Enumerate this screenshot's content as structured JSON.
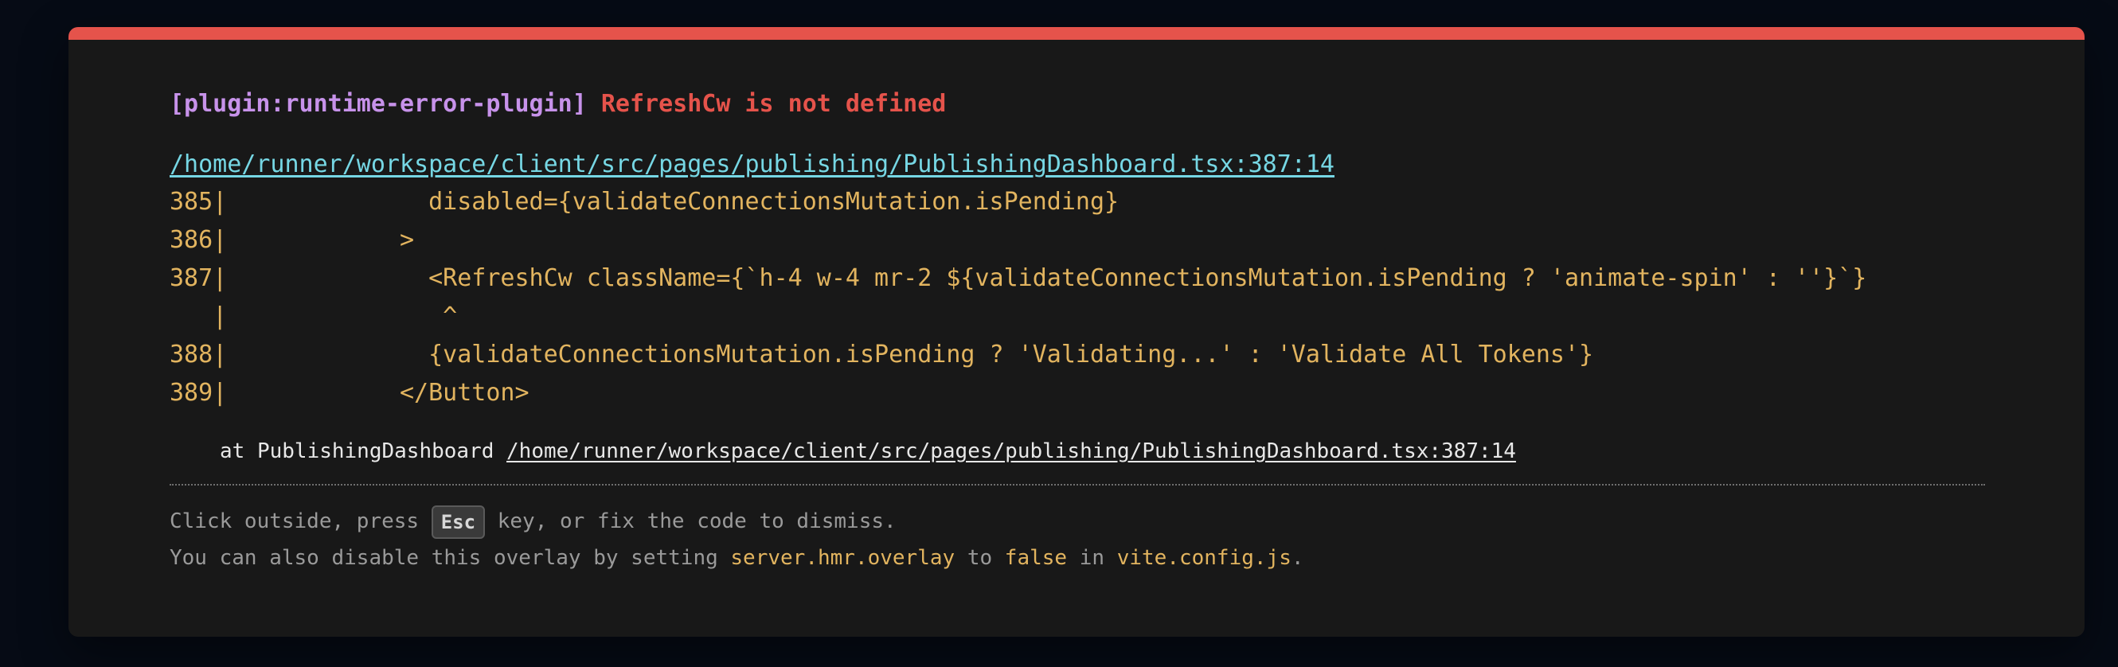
{
  "colors": {
    "page_background": "#060b15",
    "panel_background": "#181818",
    "accent_red": "#e5534b",
    "plugin_purple": "#c792ea",
    "link_cyan": "#76d7e4",
    "code_yellow": "#e2b45f"
  },
  "error": {
    "plugin": "[plugin:runtime-error-plugin]",
    "message": "RefreshCw is not defined",
    "file": "/home/runner/workspace/client/src/pages/publishing/PublishingDashboard.tsx:387:14"
  },
  "code_frame": [
    "385|              disabled={validateConnectionsMutation.isPending}",
    "386|            >",
    "387|              <RefreshCw className={`h-4 w-4 mr-2 ${validateConnectionsMutation.isPending ? 'animate-spin' : ''}`}",
    "   |               ^",
    "388|              {validateConnectionsMutation.isPending ? 'Validating...' : 'Validate All Tokens'}",
    "389|            </Button>"
  ],
  "stack": {
    "prefix": "at PublishingDashboard ",
    "file": "/home/runner/workspace/client/src/pages/publishing/PublishingDashboard.tsx:387:14"
  },
  "tip": {
    "line1_before": "Click outside, press ",
    "key": "Esc",
    "line1_after": " key, or fix the code to dismiss.",
    "line2_part1": "You can also disable this overlay by setting ",
    "line2_code1": "server.hmr.overlay",
    "line2_part2": " to ",
    "line2_code2": "false",
    "line2_part3": " in ",
    "line2_code3": "vite.config.js",
    "line2_part4": "."
  }
}
